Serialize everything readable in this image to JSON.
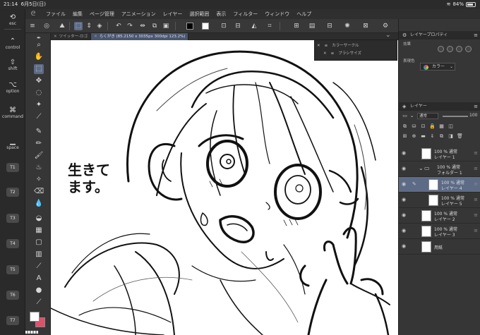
{
  "status": {
    "time": "21:14",
    "date": "6月5日(日)",
    "battery": "84%",
    "battery_level": 0.84
  },
  "menu": {
    "items": [
      "ファイル",
      "編集",
      "ページ管理",
      "アニメーション",
      "レイヤー",
      "選択範囲",
      "表示",
      "フィルター",
      "ウィンドウ",
      "ヘルプ"
    ]
  },
  "modifiers": {
    "esc": "esc",
    "control": "control",
    "shift": "shift",
    "option": "option",
    "command": "command",
    "space": "space",
    "keys": [
      "T1",
      "T2",
      "T3",
      "T4",
      "T5",
      "T6",
      "T7"
    ]
  },
  "tabs": [
    {
      "label": "ツイッター-ロゴ"
    },
    {
      "label": "らくがき (85.2150 x 3035px 300dpi 123.2%)"
    }
  ],
  "palettes": {
    "color_circle": "カラーサークル",
    "brush_size": "ブラシサイズ"
  },
  "layer_property": {
    "title": "レイヤープロパティ",
    "effect_label": "効果",
    "expression_label": "表現色",
    "expression_value": "カラー"
  },
  "layer_panel": {
    "title": "レイヤー",
    "blend_mode": "通常",
    "opacity": "100",
    "layers": [
      {
        "line1": "100 % 通常",
        "line2": "レイヤー 1",
        "selected": false
      },
      {
        "line1": "100 % 通常",
        "line2": "フォルダー 1",
        "selected": false
      },
      {
        "line1": "100 % 通常",
        "line2": "レイヤー 4",
        "selected": true
      },
      {
        "line1": "100 % 通常",
        "line2": "レイヤー 5",
        "selected": false
      },
      {
        "line1": "100 % 通常",
        "line2": "レイヤー 2",
        "selected": false
      },
      {
        "line1": "100 % 通常",
        "line2": "レイヤー 3",
        "selected": false
      },
      {
        "line1": "",
        "line2": "用紙",
        "selected": false
      }
    ]
  },
  "canvas": {
    "handwriting_line1": "生きて",
    "handwriting_line2": "ます。"
  },
  "colors": {
    "main": "#ffffff",
    "sub": "#e0506a",
    "accent": "#5d6b86"
  }
}
